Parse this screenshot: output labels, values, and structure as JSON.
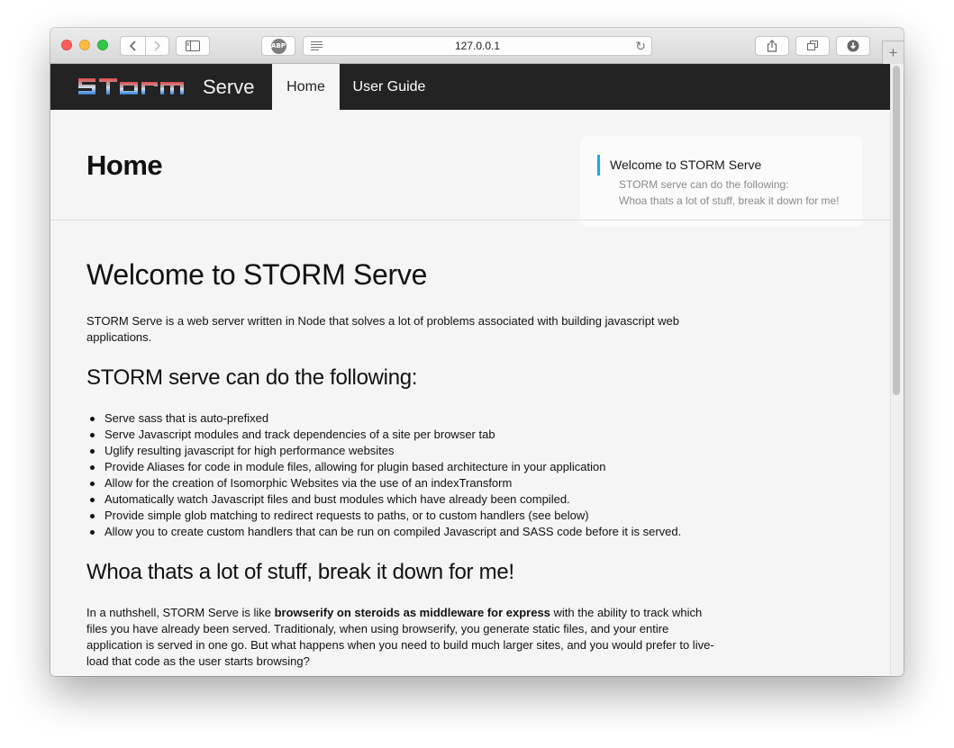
{
  "browser": {
    "url": "127.0.0.1",
    "adblock_label": "ABP",
    "new_tab_glyph": "+"
  },
  "header": {
    "logo_text": "STORM",
    "brand_sub": "Serve",
    "nav": [
      {
        "label": "Home",
        "active": true
      },
      {
        "label": "User Guide",
        "active": false
      }
    ]
  },
  "page": {
    "title": "Home"
  },
  "toc": {
    "items": [
      "Welcome to STORM Serve",
      "STORM serve can do the following:",
      "Whoa thats a lot of stuff, break it down for me!"
    ]
  },
  "article": {
    "heading": "Welcome to STORM Serve",
    "intro": "STORM Serve is a web server written in Node that solves a lot of problems associated with building javascript web applications.",
    "features_heading": "STORM serve can do the following:",
    "features": [
      "Serve sass that is auto-prefixed",
      "Serve Javascript modules and track dependencies of a site per browser tab",
      "Uglify resulting javascript for high performance websites",
      "Provide Aliases for code in module files, allowing for plugin based architecture in your application",
      "Allow for the creation of Isomorphic Websites via the use of an indexTransform",
      "Automatically watch Javascript files and bust modules which have already been compiled.",
      "Provide simple glob matching to redirect requests to paths, or to custom handlers (see below)",
      "Allow you to create custom handlers that can be run on compiled Javascript and SASS code before it is served."
    ],
    "breakdown_heading": "Whoa thats a lot of stuff, break it down for me!",
    "breakdown_pre": "In a nuthshell, STORM Serve is like ",
    "breakdown_bold": "browserify on steroids as middleware for express",
    "breakdown_post": " with the ability to track which files you have already been served. Traditionaly, when using browserify, you generate static files, and your entire application is served in one go. But what happens when you need to build much larger sites, and you would prefer to live-load that code as the user starts browsing?"
  },
  "colors": {
    "header_bg": "#232323",
    "accent": "#1ea8e8",
    "logo_top": "#d83a3a",
    "logo_bottom": "#2f7fd6"
  }
}
